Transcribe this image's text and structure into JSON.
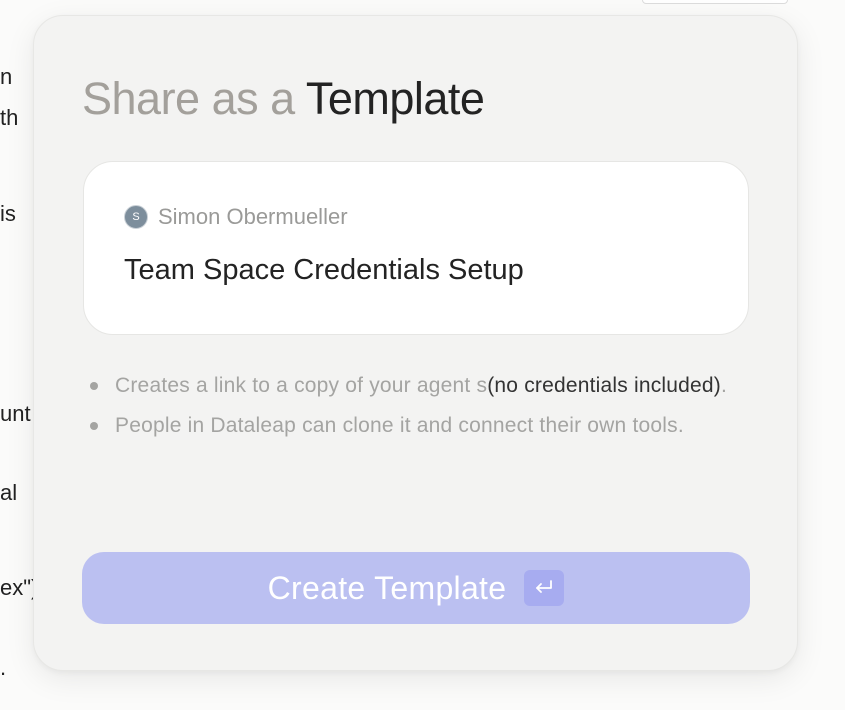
{
  "background": {
    "fragments": [
      "n",
      "th",
      "is",
      "unt",
      "al",
      "ex\")",
      "."
    ]
  },
  "modal": {
    "title_prefix": "Share as a",
    "title_main": "Template",
    "card": {
      "avatar_initial": "S",
      "author_name": "Simon Obermueller",
      "template_name": "Team Space Credentials Setup"
    },
    "bullets": [
      {
        "text": "Creates a link to a copy of your agent s",
        "emphasis": "(no credentials included)",
        "suffix": "."
      },
      {
        "text": "People in Dataleap can clone it and connect their own tools."
      }
    ],
    "create_button": {
      "label": "Create Template",
      "icon": "enter-icon"
    }
  },
  "colors": {
    "button_bg": "#bbc0f1",
    "button_key_bg": "#a7acf0",
    "title_dim": "#a3a09b",
    "title_strong": "#232323",
    "avatar_bg": "#7d8e9c"
  }
}
